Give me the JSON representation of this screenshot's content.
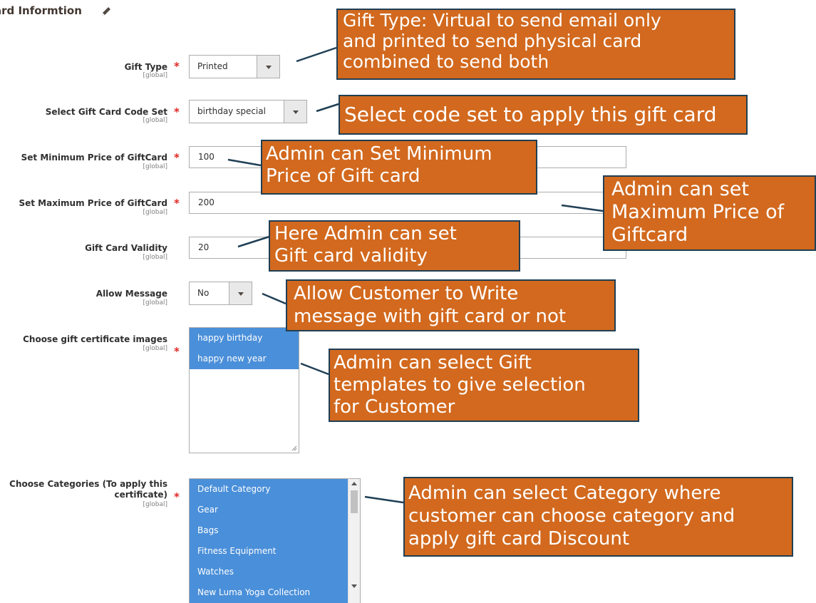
{
  "section": {
    "title": "ard Informtion"
  },
  "fields": {
    "gift_type": {
      "label": "Gift Type",
      "scope": "[global]",
      "value": "Printed"
    },
    "code_set": {
      "label": "Select Gift Card Code Set",
      "scope": "[global]",
      "value": "birthday special"
    },
    "min_price": {
      "label": "Set Minimum Price of GiftCard",
      "scope": "[global]",
      "value": "100"
    },
    "max_price": {
      "label": "Set Maximum Price of GiftCard",
      "scope": "[global]",
      "value": "200"
    },
    "validity": {
      "label": "Gift Card Validity",
      "scope": "[global]",
      "value": "20"
    },
    "allow_message": {
      "label": "Allow Message",
      "scope": "[global]",
      "value": "No"
    },
    "images": {
      "label": "Choose gift certificate images",
      "scope": "[global]",
      "options": [
        "happy birthday",
        "happy new year"
      ]
    },
    "categories": {
      "label_line1": "Choose Categories (To apply this",
      "label_line2": "certificate)",
      "scope": "[global]",
      "options": [
        "Default Category",
        "Gear",
        "Bags",
        "Fitness Equipment",
        "Watches",
        "New Luma Yoga Collection"
      ]
    }
  },
  "annotations": {
    "gift_type": [
      "Gift Type: Virtual to send email only",
      "and printed to send physical card",
      "combined to send both"
    ],
    "code_set": [
      "Select code set to apply this gift card"
    ],
    "min_price": [
      "Admin can Set Minimum",
      "Price of Gift card"
    ],
    "max_price": [
      "Admin can set",
      "Maximum Price of",
      "Giftcard"
    ],
    "validity": [
      "Here Admin can set",
      "Gift card validity"
    ],
    "allow_message": [
      "Allow Customer to Write",
      "message with gift card or not"
    ],
    "images": [
      "Admin can select Gift",
      "templates  to give selection",
      "for Customer"
    ],
    "categories": [
      "Admin can select Category where",
      "customer can choose category and",
      "apply gift card Discount"
    ]
  },
  "colors": {
    "annotation_fill": "#d2691e",
    "annotation_border": "#1f3f55",
    "selected_option": "#4a8fd9",
    "required": "#e22626"
  },
  "icons": {
    "edit": "pencil-icon",
    "dropdown": "chevron-down-icon"
  }
}
